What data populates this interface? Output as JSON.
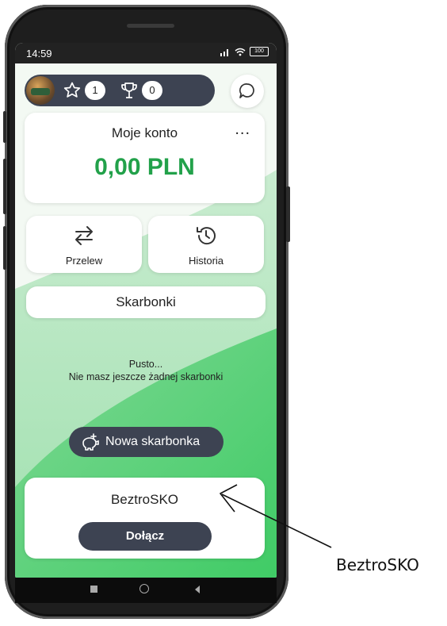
{
  "status_bar": {
    "time": "14:59",
    "battery": "100"
  },
  "top_bar": {
    "stars_count": "1",
    "trophies_count": "0"
  },
  "account": {
    "title": "Moje konto",
    "menu_label": "...",
    "balance": "0,00 PLN"
  },
  "actions": [
    {
      "label": "Przelew",
      "icon": "transfer-icon"
    },
    {
      "label": "Historia",
      "icon": "history-icon"
    }
  ],
  "piggy_banks": {
    "title": "Skarbonki",
    "empty_line1": "Pusto...",
    "empty_line2": "Nie masz jeszcze żadnej skarbonki",
    "new_button": "Nowa skarbonka"
  },
  "promo": {
    "title": "BeztroSKO",
    "join_button": "Dołącz"
  },
  "annotation": {
    "label": "BeztroSKO"
  },
  "colors": {
    "accent_green": "#22a14a",
    "dark_button": "#3d4352",
    "background_green": "#4ccf6e"
  }
}
